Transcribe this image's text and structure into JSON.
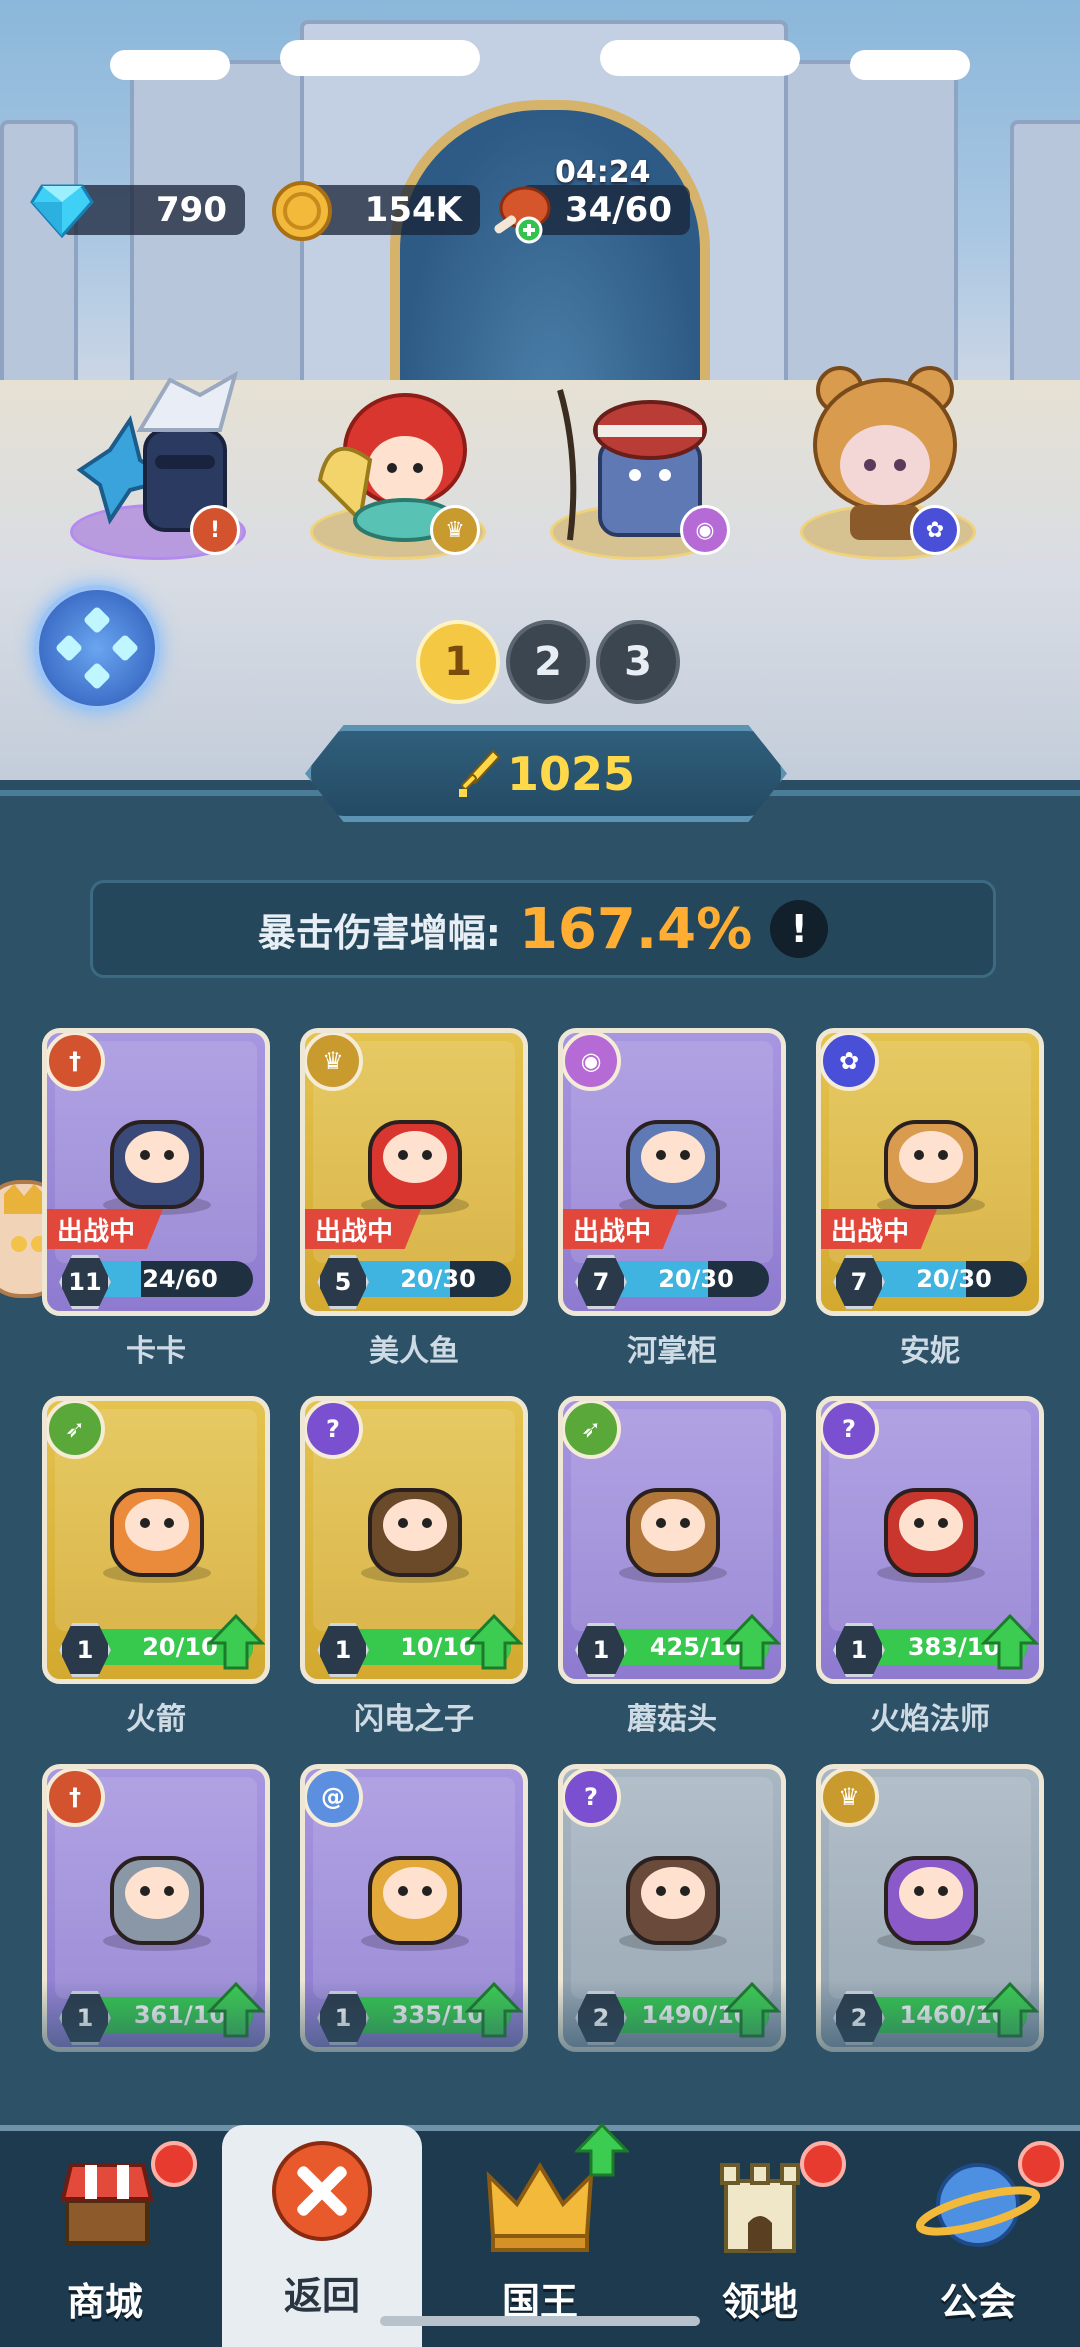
{
  "resources": {
    "gems": "790",
    "coins": "154K",
    "stamina": "34/60",
    "stamina_timer": "04:24"
  },
  "team": [
    {
      "hero": "卡卡",
      "class_icon": "sword-icon",
      "plate": "purple"
    },
    {
      "hero": "美人鱼",
      "class_icon": "crown-icon",
      "plate": "gold"
    },
    {
      "hero": "河掌柜",
      "class_icon": "eye-icon",
      "plate": "gold"
    },
    {
      "hero": "安妮",
      "class_icon": "paw-icon",
      "plate": "gold"
    }
  ],
  "team_pages": [
    "1",
    "2",
    "3"
  ],
  "active_team_page": "1",
  "power": "1025",
  "stat": {
    "label": "暴击伤害增幅:",
    "value": "167.4%",
    "info": "!"
  },
  "heroes": [
    {
      "name": "卡卡",
      "level": "11",
      "progress": "24/60",
      "fill": 0.4,
      "deployed": "出战中",
      "class_icon": "sword-icon",
      "class_color": "#d2532e",
      "frame": "purple",
      "can_upgrade": false
    },
    {
      "name": "美人鱼",
      "level": "5",
      "progress": "20/30",
      "fill": 0.67,
      "deployed": "出战中",
      "class_icon": "crown-icon",
      "class_color": "#c99a2e",
      "frame": "gold",
      "can_upgrade": false
    },
    {
      "name": "河掌柜",
      "level": "7",
      "progress": "20/30",
      "fill": 0.67,
      "deployed": "出战中",
      "class_icon": "eye-icon",
      "class_color": "#b56ad6",
      "frame": "purple",
      "can_upgrade": false
    },
    {
      "name": "安妮",
      "level": "7",
      "progress": "20/30",
      "fill": 0.67,
      "deployed": "出战中",
      "class_icon": "paw-icon",
      "class_color": "#4a4fd8",
      "frame": "gold",
      "can_upgrade": false
    },
    {
      "name": "火箭",
      "level": "1",
      "progress": "20/10",
      "fill": 1.0,
      "deployed": "",
      "class_icon": "bow-icon",
      "class_color": "#5aa83a",
      "frame": "gold",
      "can_upgrade": true
    },
    {
      "name": "闪电之子",
      "level": "1",
      "progress": "10/10",
      "fill": 1.0,
      "deployed": "",
      "class_icon": "staff-icon",
      "class_color": "#7a4fd0",
      "frame": "gold",
      "can_upgrade": true
    },
    {
      "name": "蘑菇头",
      "level": "1",
      "progress": "425/10",
      "fill": 1.0,
      "deployed": "",
      "class_icon": "bow-icon",
      "class_color": "#5aa83a",
      "frame": "purple",
      "can_upgrade": true
    },
    {
      "name": "火焰法师",
      "level": "1",
      "progress": "383/10",
      "fill": 1.0,
      "deployed": "",
      "class_icon": "staff-icon",
      "class_color": "#7a4fd0",
      "frame": "purple",
      "can_upgrade": true
    },
    {
      "name": "",
      "level": "1",
      "progress": "361/10",
      "fill": 1.0,
      "deployed": "",
      "class_icon": "sword-icon",
      "class_color": "#d2532e",
      "frame": "purple",
      "can_upgrade": true
    },
    {
      "name": "",
      "level": "1",
      "progress": "335/10",
      "fill": 1.0,
      "deployed": "",
      "class_icon": "swirl-icon",
      "class_color": "#5d8fe0",
      "frame": "purple",
      "can_upgrade": true
    },
    {
      "name": "",
      "level": "2",
      "progress": "1490/10",
      "fill": 1.0,
      "deployed": "",
      "class_icon": "staff-icon",
      "class_color": "#7a4fd0",
      "frame": "gray",
      "can_upgrade": true
    },
    {
      "name": "",
      "level": "2",
      "progress": "1460/10",
      "fill": 1.0,
      "deployed": "",
      "class_icon": "crown-icon",
      "class_color": "#c99a2e",
      "frame": "gray",
      "can_upgrade": true
    }
  ],
  "nav": {
    "shop": "商城",
    "back": "返回",
    "king": "国王",
    "territory": "领地",
    "guild": "公会"
  },
  "colors": {
    "accent_orange": "#ffae33",
    "power_yellow": "#ffd94a",
    "notification_red": "#e83b30"
  }
}
